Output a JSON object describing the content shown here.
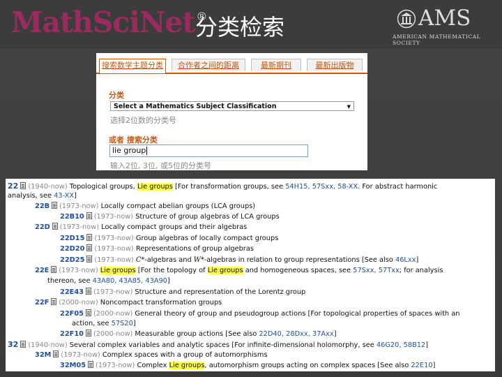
{
  "header": {
    "logo": "MathSciNet",
    "logo_mark": "®",
    "title": "分类检索",
    "ams_name": "AMS",
    "ams_subtitle": "AMERICAN MATHEMATICAL SOCIETY"
  },
  "search_panel": {
    "tabs": [
      {
        "label": "搜索数学主题分类",
        "active": true
      },
      {
        "label": "合作者之间的距离",
        "active": false
      },
      {
        "label": "最新期刊",
        "active": false
      },
      {
        "label": "最新出版物",
        "active": false
      }
    ],
    "classification_label": "分类",
    "classification_select": "Select a Mathematics Subject Classification",
    "classification_hint": "选择2位数的分类号",
    "search_label": "或者 搜索分类",
    "search_value": "lie group",
    "search_hint": "输入2位, 3位, 或5位的分类号"
  },
  "results": [
    {
      "code": "22",
      "range": "(1940-now)",
      "text_a": "Topological groups, ",
      "hl": "Lie groups",
      "text_b": " [For transformation groups, see ",
      "refs": "54H15, 57Sxx, 58-XX",
      "text_c": ". For abstract harmonic"
    },
    {
      "continuation": "analysis, see ",
      "refs": "43-XX",
      "end": "]"
    },
    {
      "code": "22B",
      "range": "(1973-now)",
      "text": "Locally compact abelian groups (LCA groups)"
    },
    {
      "code": "22B10",
      "range": "(1973-now)",
      "text": "Structure of group algebras of LCA groups"
    },
    {
      "code": "22D",
      "range": "(1973-now)",
      "text": "Locally compact groups and their algebras"
    },
    {
      "code": "22D15",
      "range": "(1973-now)",
      "text": "Group algebras of locally compact groups"
    },
    {
      "code": "22D20",
      "range": "(1973-now)",
      "text": "Representations of group algebras"
    },
    {
      "code": "22D25",
      "range": "(1973-now)",
      "math_a": "C*",
      "text_a": "-algebras and ",
      "math_b": "W*",
      "text_b": "-algebras in relation to group representations [See also ",
      "refs": "46Lxx",
      "end": "]"
    },
    {
      "code": "22E",
      "range": "(1973-now)",
      "hl_a": "Lie groups",
      "text_a": " [For the topology of ",
      "hl_b": "Lie groups",
      "text_b": " and homogeneous spaces, see ",
      "refs": "57Sxx, 57Txx",
      "text_c": "; for analysis"
    },
    {
      "continuation": "thereon, see ",
      "refs": "43A80, 43A85, 43A90",
      "end": "]"
    },
    {
      "code": "22E43",
      "range": "(1973-now)",
      "text": "Structure and representation of the Lorentz group"
    },
    {
      "code": "22F",
      "range": "(2000-now)",
      "text": "Noncompact transformation groups"
    },
    {
      "code": "22F05",
      "range": "(2000-now)",
      "text": "General theory of group and pseudogroup actions [For topological properties of spaces with an"
    },
    {
      "continuation": "action, see ",
      "refs": "57S20",
      "end": "]"
    },
    {
      "code": "22F10",
      "range": "(2000-now)",
      "text": "Measurable group actions [See also ",
      "refs": "22D40, 28Dxx, 37Axx",
      "end": "]"
    },
    {
      "code": "32",
      "range": "(1940-now)",
      "text": "Several complex variables and analytic spaces [For infinite-dimensional holomorphy, see ",
      "refs": "46G20, 58B12",
      "end": "]"
    },
    {
      "code": "32M",
      "range": "(1973-now)",
      "text": "Complex spaces with a group of automorphisms"
    },
    {
      "code": "32M05",
      "range": "(1973-now)",
      "text_a": "Complex ",
      "hl": "Lie groups",
      "text_b": ", automorphism groups acting on complex spaces [See also ",
      "refs": "22E10",
      "end": "]"
    }
  ]
}
